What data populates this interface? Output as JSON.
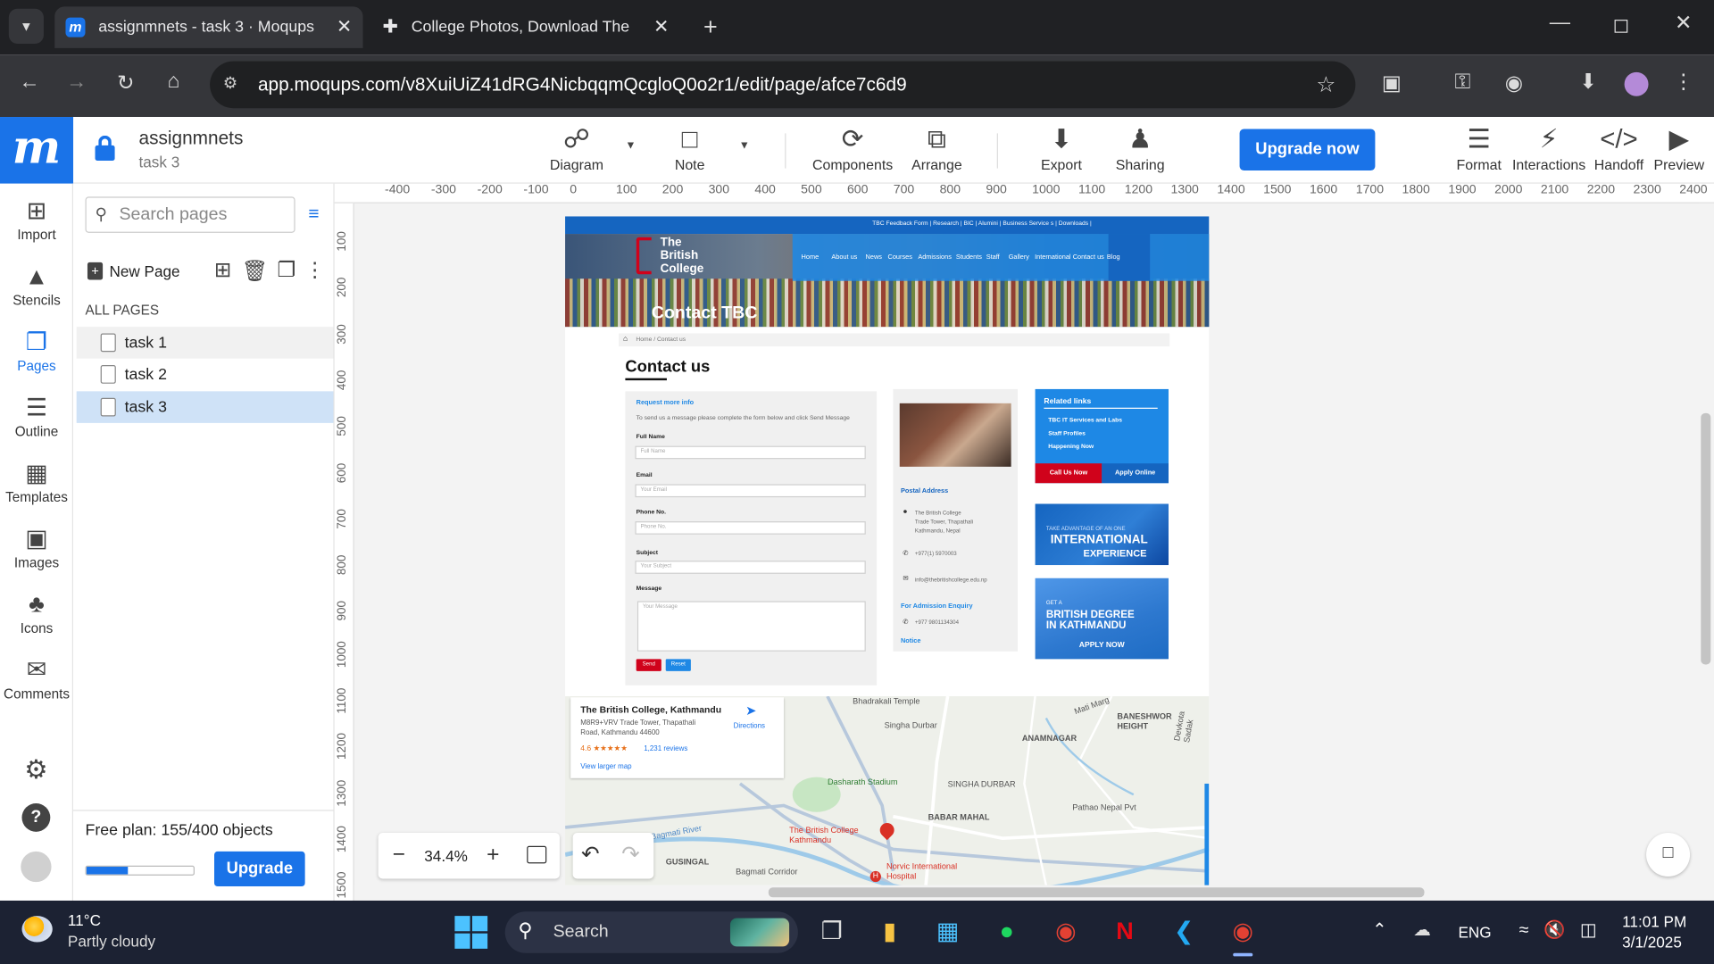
{
  "browser": {
    "tabs": [
      {
        "title": "assignmnets - task 3 · Moqups",
        "active": true
      },
      {
        "title": "College Photos, Download The",
        "active": false
      }
    ],
    "url": "app.moqups.com/v8XuiUiZ41dRG4NicbqqmQcgloQ0o2r1/edit/page/afce7c6d9"
  },
  "app": {
    "project_name": "assignmnets",
    "page_name": "task 3",
    "toolbar": {
      "diagram": "Diagram",
      "note": "Note",
      "components": "Components",
      "arrange": "Arrange",
      "export": "Export",
      "sharing": "Sharing",
      "upgrade_now": "Upgrade now",
      "format": "Format",
      "interactions": "Interactions",
      "handoff": "Handoff",
      "preview": "Preview"
    },
    "rail": {
      "import": "Import",
      "stencils": "Stencils",
      "pages": "Pages",
      "outline": "Outline",
      "templates": "Templates",
      "images": "Images",
      "icons": "Icons",
      "comments": "Comments"
    },
    "pages_panel": {
      "search_placeholder": "Search pages",
      "new_page": "New Page",
      "all_pages_heading": "ALL PAGES",
      "pages": [
        {
          "name": "task 1",
          "selected": false
        },
        {
          "name": "task 2",
          "selected": false
        },
        {
          "name": "task 3",
          "selected": true
        }
      ],
      "plan_text": "Free plan: 155/400 objects",
      "plan_progress": 0.3875,
      "upgrade_label": "Upgrade"
    },
    "zoom": "34.4%",
    "ruler_h": [
      "-400",
      "-300",
      "-200",
      "-100",
      "0",
      "100",
      "200",
      "300",
      "400",
      "500",
      "600",
      "700",
      "800",
      "900",
      "1000",
      "1100",
      "1200",
      "1300",
      "1400",
      "1500",
      "1600",
      "1700",
      "1800",
      "1900",
      "2000",
      "2100",
      "2200",
      "2300",
      "2400"
    ],
    "ruler_v": [
      "100",
      "200",
      "300",
      "400",
      "500",
      "600",
      "700",
      "800",
      "900",
      "1000",
      "1100",
      "1200",
      "1300",
      "1400",
      "1500"
    ]
  },
  "canvas_site": {
    "topbar_links": "TBC Feedback Form | Research | BIC | Alumini | Business Service s | Downloads |",
    "logo_text": [
      "The",
      "British",
      "College"
    ],
    "menu": [
      "Home",
      "About us",
      "News",
      "Courses",
      "Admissions",
      "Students",
      "Staff",
      "Gallery",
      "International",
      "Contact us",
      "Blog"
    ],
    "hero_title": "Contact TBC",
    "breadcrumb": "Home / Contact us",
    "page_heading": "Contact us",
    "form": {
      "title": "Request more info",
      "intro": "To send us a message please complete the form below and click Send Message",
      "full_name_label": "Full Name",
      "full_name_ph": "Full Name",
      "email_label": "Email",
      "email_ph": "Your Email",
      "phone_label": "Phone No.",
      "phone_ph": "Phone No.",
      "subject_label": "Subject",
      "subject_ph": "Your Subject",
      "message_label": "Message",
      "message_ph": "Your Message",
      "send": "Send",
      "reset": "Reset"
    },
    "address": {
      "postal_heading": "Postal Address",
      "postal_lines": [
        "The British College",
        "Trade Tower, Thapathali",
        "Kathmandu, Nepal"
      ],
      "phone": "+977(1) 5970003",
      "email": "info@thebritishcollege.edu.np",
      "enquiry_heading": "For Admission Enquiry",
      "enquiry_phone": "+977 9801134304",
      "notice": "Notice"
    },
    "related": {
      "heading": "Related links",
      "links": [
        "TBC IT Services and Labs",
        "Staff Profiles",
        "Happening Now"
      ],
      "call_us": "Call Us Now",
      "apply": "Apply Online"
    },
    "banner1": {
      "small": "TAKE ADVANTAGE OF AN ONE",
      "big1": "INTERNATIONAL",
      "big2": "EXPERIENCE"
    },
    "banner2": {
      "small": "GET A",
      "big1": "BRITISH DEGREE",
      "big2": "IN KATHMANDU",
      "cta": "APPLY NOW"
    },
    "map": {
      "place_name": "The British College, Kathmandu",
      "place_addr1": "M8R9+VRV Trade Tower, Thapathali",
      "place_addr2": "Road, Kathmandu 44600",
      "rating": "4.6 ★★★★★",
      "reviews": "1,231 reviews",
      "directions": "Directions",
      "larger_map": "View larger map",
      "labels": [
        "Bhadrakali Temple",
        "Singha Durbar",
        "ANAMNAGAR",
        "BANESHWOR HEIGHT",
        "Dasharath Stadium",
        "SINGHA DURBAR",
        "BABAR MAHAL",
        "The British College Kathmandu",
        "Pathao Nepal Pvt",
        "Norvic International Hospital",
        "GUSINGAL",
        "Bagmati River",
        "Bagmati Corridor",
        "Mati Marg",
        "Devkota Sadak"
      ]
    }
  },
  "taskbar": {
    "temp": "11°C",
    "weather": "Partly cloudy",
    "search": "Search",
    "lang": "ENG",
    "time": "11:01 PM",
    "date": "3/1/2025"
  },
  "colors": {
    "moqups_blue": "#1a73e8",
    "site_blue": "#1e88e5",
    "site_red": "#d0021b",
    "chrome_dark": "#202124",
    "taskbar": "#1c2233"
  }
}
